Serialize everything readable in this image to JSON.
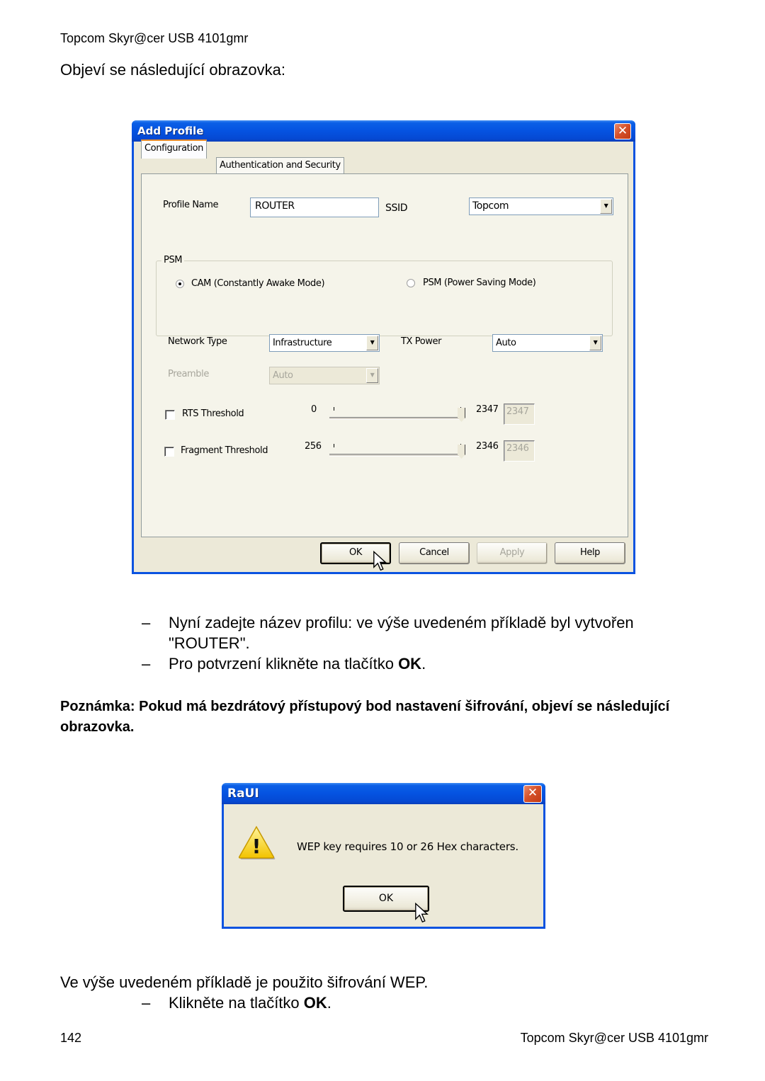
{
  "page": {
    "header": "Topcom Skyr@cer USB 4101gmr",
    "intro": "Objeví se následující obrazovka:",
    "bullets": [
      {
        "dash": "–",
        "text": "Nyní zadejte název profilu: ve výše uvedeném příkladě byl vytvořen \"ROUTER\"."
      },
      {
        "dash": "–",
        "text_before": "Pro potvrzení klikněte na tlačítko ",
        "bold": "OK",
        "text_after": "."
      }
    ],
    "note": "Poznámka: Pokud má bezdrátový přístupový bod nastavení šifrování, objeví se následující obrazovka.",
    "wep_text": "Ve výše uvedeném příkladě je použito šifrování WEP.",
    "wep_bullet": {
      "dash": "–",
      "text_before": "Klikněte na tlačítko ",
      "bold": "OK",
      "text_after": "."
    },
    "footer": {
      "page_number": "142",
      "product": "Topcom Skyr@cer USB 4101gmr"
    }
  },
  "add_profile": {
    "title": "Add Profile",
    "close_glyph": "✕",
    "tabs": [
      {
        "label": "Configuration",
        "active": true
      },
      {
        "label": "Authentication and Security",
        "active": false
      }
    ],
    "profile_name_label": "Profile Name",
    "profile_name_value": "ROUTER",
    "ssid_label": "SSID",
    "ssid_value": "Topcom",
    "psm_group_label": "PSM",
    "radio_cam": {
      "label": "CAM (Constantly Awake Mode)",
      "checked": true
    },
    "radio_psm": {
      "label": "PSM (Power Saving Mode)",
      "checked": false
    },
    "network_type_label": "Network Type",
    "network_type_value": "Infrastructure",
    "tx_power_label": "TX Power",
    "tx_power_value": "Auto",
    "preamble_label": "Preamble",
    "preamble_value": "Auto",
    "rts": {
      "label": "RTS Threshold",
      "checked": false,
      "min": "0",
      "max": "2347",
      "value": "2347"
    },
    "fragment": {
      "label": "Fragment Threshold",
      "checked": false,
      "min": "256",
      "max": "2346",
      "value": "2346"
    },
    "buttons": {
      "ok": "OK",
      "cancel": "Cancel",
      "apply": "Apply",
      "help": "Help"
    },
    "dropdown_arrow": "▼"
  },
  "raui": {
    "title": "RaUI",
    "close_glyph": "✕",
    "message": "WEP key requires 10 or 26 Hex characters.",
    "ok": "OK",
    "warning_glyph": "!"
  }
}
